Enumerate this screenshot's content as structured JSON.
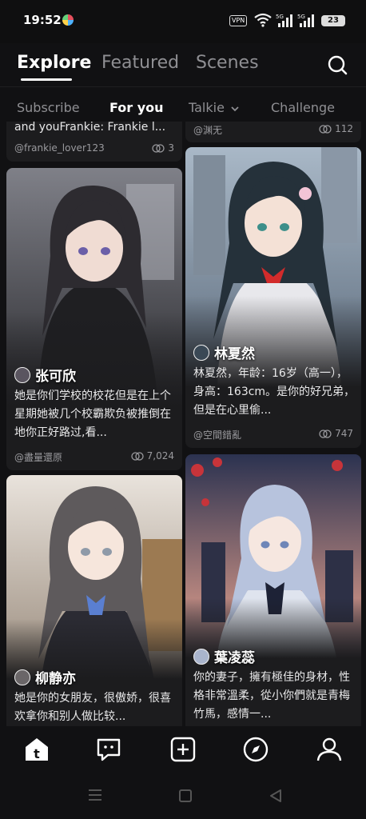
{
  "status": {
    "time": "19:52",
    "vpn": "VPN",
    "battery": "23",
    "net1": "5G",
    "net2": "5G"
  },
  "top_tabs": [
    {
      "label": "Explore"
    },
    {
      "label": "Featured"
    },
    {
      "label": "Scenes"
    }
  ],
  "sub_tabs": [
    {
      "label": "Subscribe"
    },
    {
      "label": "For you"
    },
    {
      "label": "Talkie"
    },
    {
      "label": "Challenge"
    }
  ],
  "cards": [
    {
      "name": "",
      "desc": "and youFrankie: Frankie l...",
      "author": "@frankie_lover123",
      "count": "3"
    },
    {
      "name": "",
      "desc": "",
      "author": "@渊无",
      "count": "112"
    },
    {
      "name": "张可欣",
      "desc": "她是你们学校的校花但是在上个星期她被几个校霸欺负被推倒在地你正好路过,看...",
      "author": "@盡量還原",
      "count": "7,024"
    },
    {
      "name": "林夏然",
      "desc": "林夏然，年龄：16岁（高一），身高：163cm。是你的好兄弟，但是在心里偷...",
      "author": "@空間錯亂",
      "count": "747"
    },
    {
      "name": "柳静亦",
      "desc": "她是你的女朋友，很傲娇，很喜欢拿你和别人做比较...",
      "author": "",
      "count": ""
    },
    {
      "name": "葉凌蕊",
      "desc": "你的妻子，擁有極佳的身材，性格非常溫柔，從小你們就是青梅竹馬，感情一...",
      "author": "",
      "count": ""
    }
  ]
}
